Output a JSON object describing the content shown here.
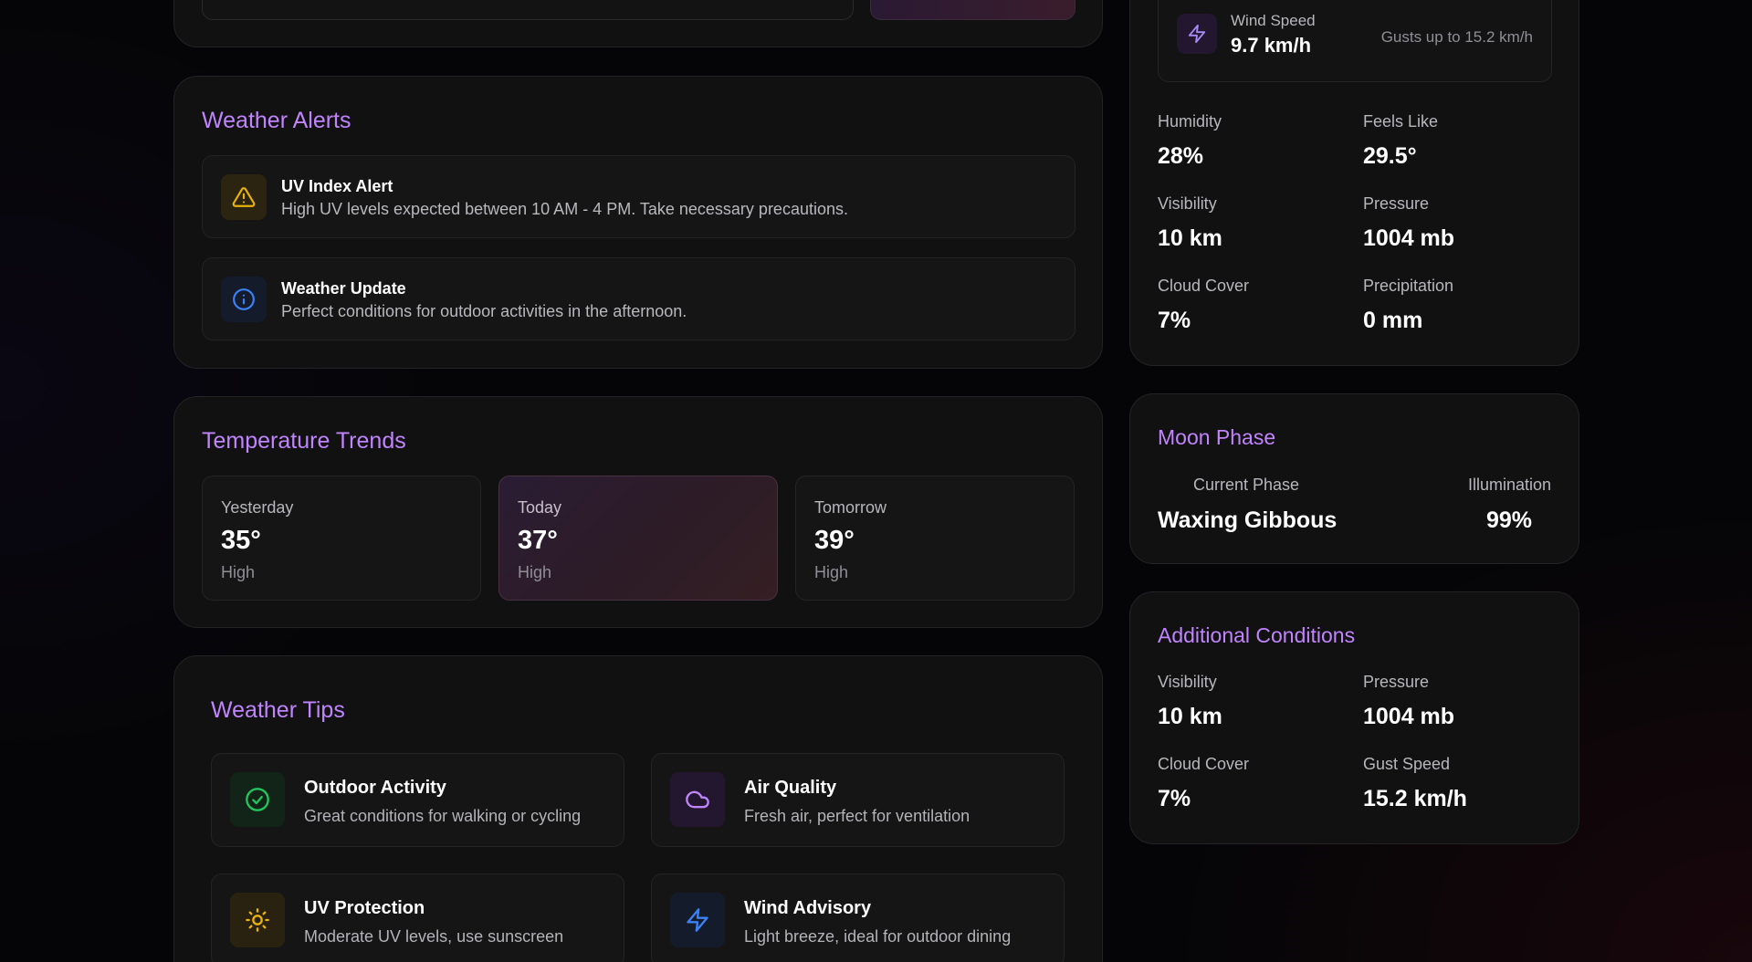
{
  "top_left": {
    "location_action_label": ""
  },
  "alerts": {
    "title": "Weather Alerts",
    "items": [
      {
        "icon": "warning-triangle-icon",
        "title": "UV Index Alert",
        "text": "High UV levels expected between 10 AM - 4 PM. Take necessary precautions."
      },
      {
        "icon": "info-circle-icon",
        "title": "Weather Update",
        "text": "Perfect conditions for outdoor activities in the afternoon."
      }
    ]
  },
  "trends": {
    "title": "Temperature Trends",
    "days": [
      {
        "day": "Yesterday",
        "temp": "35°",
        "sub": "High"
      },
      {
        "day": "Today",
        "temp": "37°",
        "sub": "High"
      },
      {
        "day": "Tomorrow",
        "temp": "39°",
        "sub": "High"
      }
    ]
  },
  "tips": {
    "title": "Weather Tips",
    "items": [
      {
        "icon": "check-circle-icon",
        "title": "Outdoor Activity",
        "text": "Great conditions for walking or cycling"
      },
      {
        "icon": "cloud-icon",
        "title": "Air Quality",
        "text": "Fresh air, perfect for ventilation"
      },
      {
        "icon": "sun-icon",
        "title": "UV Protection",
        "text": "Moderate UV levels, use sunscreen"
      },
      {
        "icon": "lightning-icon",
        "title": "Wind Advisory",
        "text": "Light breeze, ideal for outdoor dining"
      }
    ]
  },
  "current": {
    "wind": {
      "label": "Wind Speed",
      "value": "9.7 km/h",
      "gusts": "Gusts up to 15.2 km/h"
    },
    "stats": [
      {
        "label": "Humidity",
        "value": "28%"
      },
      {
        "label": "Feels Like",
        "value": "29.5°"
      },
      {
        "label": "Visibility",
        "value": "10 km"
      },
      {
        "label": "Pressure",
        "value": "1004 mb"
      },
      {
        "label": "Cloud Cover",
        "value": "7%"
      },
      {
        "label": "Precipitation",
        "value": "0 mm"
      }
    ]
  },
  "moon": {
    "title": "Moon Phase",
    "phase_label": "Current Phase",
    "phase_value": "Waxing Gibbous",
    "illum_label": "Illumination",
    "illum_value": "99%"
  },
  "additional": {
    "title": "Additional Conditions",
    "stats": [
      {
        "label": "Visibility",
        "value": "10 km"
      },
      {
        "label": "Pressure",
        "value": "1004 mb"
      },
      {
        "label": "Cloud Cover",
        "value": "7%"
      },
      {
        "label": "Gust Speed",
        "value": "15.2 km/h"
      }
    ]
  },
  "colors": {
    "accent": "#c084fc",
    "warning": "#eab308",
    "info": "#3b82f6",
    "success": "#22c55e"
  }
}
